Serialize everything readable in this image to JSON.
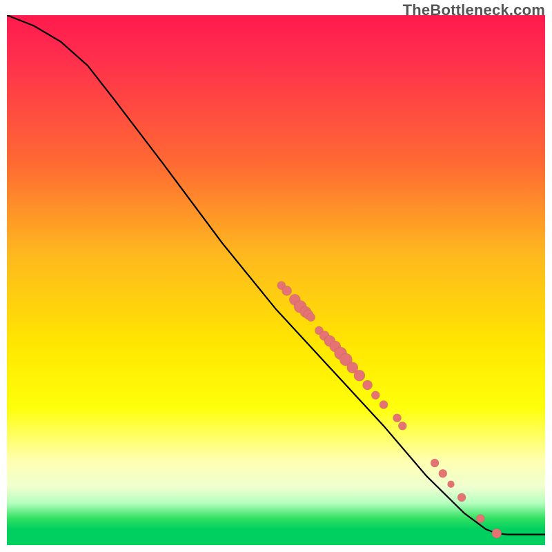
{
  "watermark": "TheBottleneck.com",
  "chart_data": {
    "type": "line",
    "title": "",
    "xlabel": "",
    "ylabel": "",
    "xlim": [
      0,
      100
    ],
    "ylim": [
      0,
      100
    ],
    "series": [
      {
        "name": "curve",
        "points": [
          [
            0,
            100
          ],
          [
            5,
            98
          ],
          [
            10,
            95
          ],
          [
            15,
            90.5
          ],
          [
            20,
            84
          ],
          [
            29,
            72
          ],
          [
            40,
            57
          ],
          [
            50,
            44.5
          ],
          [
            60,
            33.5
          ],
          [
            70,
            22.5
          ],
          [
            78,
            13
          ],
          [
            85,
            6
          ],
          [
            89,
            3
          ],
          [
            91,
            2.2
          ],
          [
            93,
            2.0
          ],
          [
            100,
            2.0
          ]
        ]
      }
    ],
    "scatter": [
      {
        "x": 51.0,
        "y": 49.0,
        "r": 6
      },
      {
        "x": 52.0,
        "y": 48.0,
        "r": 7
      },
      {
        "x": 53.5,
        "y": 46.3,
        "r": 8
      },
      {
        "x": 54.5,
        "y": 45.0,
        "r": 9
      },
      {
        "x": 55.5,
        "y": 44.0,
        "r": 8
      },
      {
        "x": 56.0,
        "y": 43.5,
        "r": 7
      },
      {
        "x": 56.5,
        "y": 43.0,
        "r": 6
      },
      {
        "x": 58.0,
        "y": 40.5,
        "r": 6
      },
      {
        "x": 59.0,
        "y": 39.5,
        "r": 7
      },
      {
        "x": 60.0,
        "y": 38.5,
        "r": 8
      },
      {
        "x": 61.0,
        "y": 37.5,
        "r": 8
      },
      {
        "x": 62.0,
        "y": 36.2,
        "r": 9
      },
      {
        "x": 63.0,
        "y": 35.0,
        "r": 9
      },
      {
        "x": 64.2,
        "y": 33.5,
        "r": 8
      },
      {
        "x": 65.5,
        "y": 32.0,
        "r": 8
      },
      {
        "x": 67.0,
        "y": 30.2,
        "r": 7
      },
      {
        "x": 68.5,
        "y": 28.3,
        "r": 6
      },
      {
        "x": 70.0,
        "y": 26.5,
        "r": 6
      },
      {
        "x": 72.5,
        "y": 24.0,
        "r": 6
      },
      {
        "x": 73.5,
        "y": 22.5,
        "r": 6
      },
      {
        "x": 79.5,
        "y": 15.5,
        "r": 6
      },
      {
        "x": 81.0,
        "y": 13.5,
        "r": 6
      },
      {
        "x": 82.5,
        "y": 11.5,
        "r": 5
      },
      {
        "x": 84.5,
        "y": 9.0,
        "r": 6
      },
      {
        "x": 88.0,
        "y": 5.0,
        "r": 6
      },
      {
        "x": 91.0,
        "y": 2.2,
        "r": 7
      }
    ],
    "colors": {
      "curve": "#000000",
      "dot_fill": "#e57373",
      "gradient_top": "#ff1a4d",
      "gradient_mid": "#ffe600",
      "gradient_bottom": "#00d060"
    }
  }
}
